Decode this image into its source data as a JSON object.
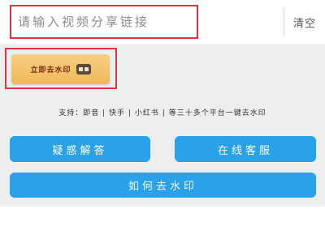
{
  "input": {
    "placeholder": "请输入视频分享链接",
    "value": ""
  },
  "clear_label": "清空",
  "watermark_button": {
    "label": "立即去水印",
    "icon": "video-icon"
  },
  "support": {
    "prefix": "支持：",
    "platforms": [
      "即音",
      "快手",
      "小红书"
    ],
    "suffix": "等三十多个平台一键去水印",
    "separator": "|"
  },
  "buttons": {
    "faq_label": "疑惑解答",
    "service_label": "在线客服",
    "howto_label": "如何去水印"
  },
  "colors": {
    "highlight": "#e0343f",
    "primary_blue": "#2aa1e8",
    "gold": "#f2c06a"
  }
}
